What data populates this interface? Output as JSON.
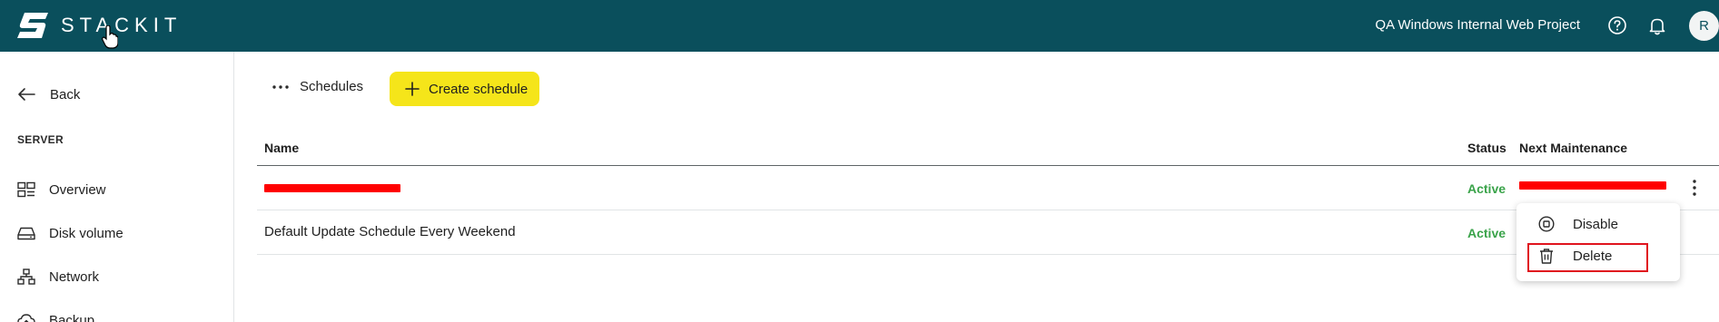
{
  "header": {
    "logo_text": "STACKIT",
    "project_name": "QA Windows Internal Web Project",
    "avatar_initial": "R",
    "icons": [
      "help-circle-icon",
      "bell-icon"
    ]
  },
  "sidebar": {
    "back_label": "Back",
    "section_title": "SERVER",
    "items": [
      {
        "label": "Overview",
        "icon": "overview-grid-icon"
      },
      {
        "label": "Disk volume",
        "icon": "disk-icon"
      },
      {
        "label": "Network",
        "icon": "network-icon"
      },
      {
        "label": "Backup",
        "icon": "cloud-backup-icon"
      }
    ]
  },
  "toolbar": {
    "schedules_label": "Schedules",
    "create_button_label": "Create schedule"
  },
  "table": {
    "columns": [
      "Name",
      "Status",
      "Next Maintenance"
    ],
    "rows": [
      {
        "name": "",
        "status": "Active",
        "next_maintenance": ""
      },
      {
        "name": "Default Update Schedule Every Weekend",
        "status": "Active",
        "next_maintenance": ""
      }
    ]
  },
  "row_menu": {
    "items": [
      {
        "label": "Disable",
        "icon": "disable-icon"
      },
      {
        "label": "Delete",
        "icon": "trash-icon"
      }
    ]
  },
  "colors": {
    "topbar": "#0a4f5c",
    "accent_button": "#f5e51a",
    "status_active": "#3aa34a",
    "redaction": "#ff0000",
    "highlight": "#e0141e"
  }
}
